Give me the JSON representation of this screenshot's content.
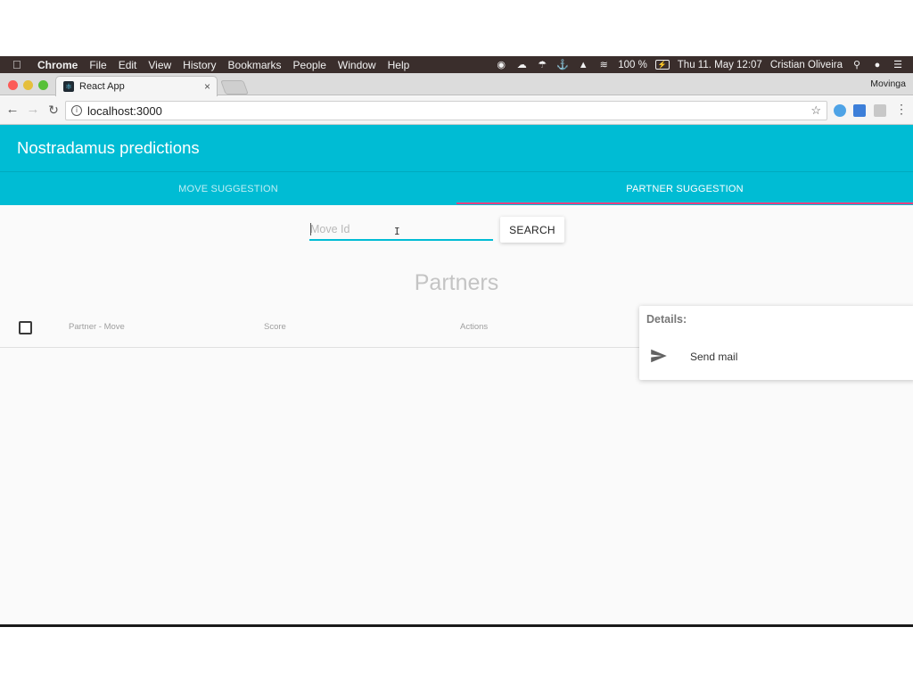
{
  "menubar": {
    "app_name": "Chrome",
    "items": [
      "File",
      "Edit",
      "View",
      "History",
      "Bookmarks",
      "People",
      "Window",
      "Help"
    ],
    "battery": "100 %",
    "datetime": "Thu 11. May 12:07",
    "user": "Cristian Oliveira"
  },
  "browser": {
    "tab_title": "React App",
    "profile": "Movinga",
    "url": "localhost:3000"
  },
  "app": {
    "title": "Nostradamus predictions",
    "tabs": [
      "MOVE SUGGESTION",
      "PARTNER SUGGESTION"
    ],
    "active_tab": 1,
    "accent_color": "#00bcd4",
    "ink_color": "#ff4081"
  },
  "search": {
    "placeholder": "Move Id",
    "value": "",
    "button_label": "SEARCH"
  },
  "partners": {
    "title": "Partners",
    "columns": [
      "Partner - Move",
      "Score",
      "Actions"
    ],
    "rows": []
  },
  "details": {
    "title": "Details:",
    "actions": [
      {
        "label": "Send mail",
        "icon": "send-icon"
      }
    ]
  }
}
